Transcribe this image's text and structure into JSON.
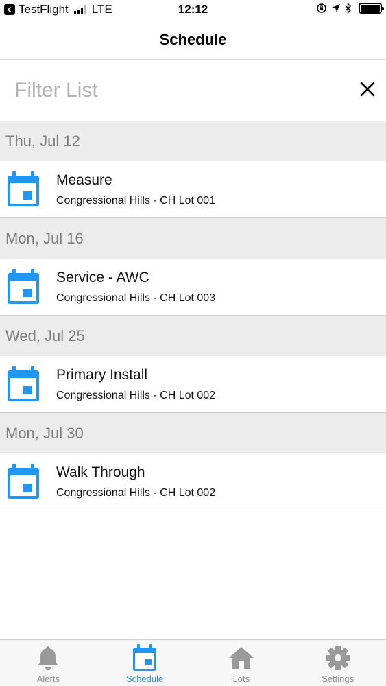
{
  "status_bar": {
    "carrier_app": "TestFlight",
    "network": "LTE",
    "time": "12:12"
  },
  "nav": {
    "title": "Schedule"
  },
  "filter": {
    "placeholder": "Filter List",
    "value": ""
  },
  "schedule": [
    {
      "date": "Thu, Jul 12",
      "items": [
        {
          "title": "Measure",
          "subtitle": "Congressional Hills - CH Lot 001"
        }
      ]
    },
    {
      "date": "Mon, Jul 16",
      "items": [
        {
          "title": "Service - AWC",
          "subtitle": "Congressional Hills - CH Lot 003"
        }
      ]
    },
    {
      "date": "Wed, Jul 25",
      "items": [
        {
          "title": "Primary Install",
          "subtitle": "Congressional Hills - CH Lot 002"
        }
      ]
    },
    {
      "date": "Mon, Jul 30",
      "items": [
        {
          "title": "Walk Through",
          "subtitle": "Congressional Hills - CH Lot 002"
        }
      ]
    }
  ],
  "tabs": [
    {
      "label": "Alerts",
      "icon": "bell-icon",
      "active": false
    },
    {
      "label": "Schedule",
      "icon": "calendar-icon",
      "active": true
    },
    {
      "label": "Lots",
      "icon": "home-icon",
      "active": false
    },
    {
      "label": "Settings",
      "icon": "gear-icon",
      "active": false
    }
  ],
  "colors": {
    "accent": "#2196f3",
    "inactive_tab": "#9a9a9a",
    "section_bg": "#ececec"
  }
}
